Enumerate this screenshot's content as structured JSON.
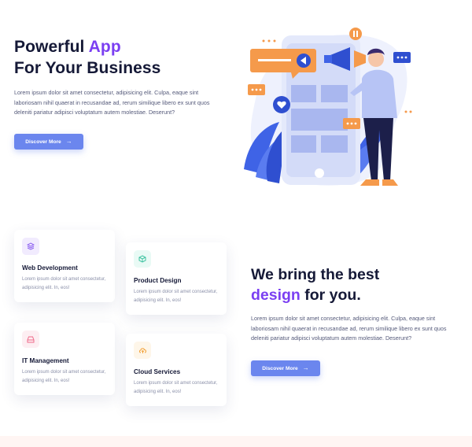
{
  "hero": {
    "title_line1_a": "Powerful ",
    "title_line1_b": "App",
    "title_line2": "For Your Business",
    "text": "Lorem ipsum dolor sit amet consectetur, adipisicing elit. Culpa, eaque sint laboriosam nihil quaerat in recusandae ad, rerum similique libero ex sunt quos deleniti pariatur adipisci voluptatum autem molestiae. Deserunt?",
    "button_label": "Discover More",
    "arrow": "→"
  },
  "services": [
    {
      "title": "Web Development",
      "text": "Lorem ipsum dolor sit amet consectetur, adipisicing elit. In, eos!",
      "icon": "layers-icon",
      "icon_color": "#8e63f0",
      "icon_bg": "#f1ebfe"
    },
    {
      "title": "Product Design",
      "text": "Lorem ipsum dolor sit amet consectetur, adipisicing elit. In, eos!",
      "icon": "cube-icon",
      "icon_color": "#3cc2a0",
      "icon_bg": "#e9faf5"
    },
    {
      "title": "IT Management",
      "text": "Lorem ipsum dolor sit amet consectetur, adipisicing elit. In, eos!",
      "icon": "hard-drive-icon",
      "icon_color": "#ef6a8a",
      "icon_bg": "#fdeef2"
    },
    {
      "title": "Cloud Services",
      "text": "Lorem ipsum dolor sit amet consectetur, adipisicing elit. In, eos!",
      "icon": "cloud-upload-icon",
      "icon_color": "#f2a23a",
      "icon_bg": "#fef6e9"
    }
  ],
  "section2": {
    "title_line1": "We bring the best",
    "title_line2_a": "design",
    "title_line2_b": " for you.",
    "text": "Lorem ipsum dolor sit amet consectetur, adipisicing elit. Culpa, eaque sint laboriosam nihil quaerat in recusandae ad, rerum similique libero ex sunt quos deleniti pariatur adipisci voluptatum autem molestiae. Deserunt?",
    "button_label": "Discover More",
    "arrow": "→"
  },
  "colors": {
    "accent": "#7b3ff2",
    "button": "#6b86ee",
    "heading": "#151937"
  }
}
